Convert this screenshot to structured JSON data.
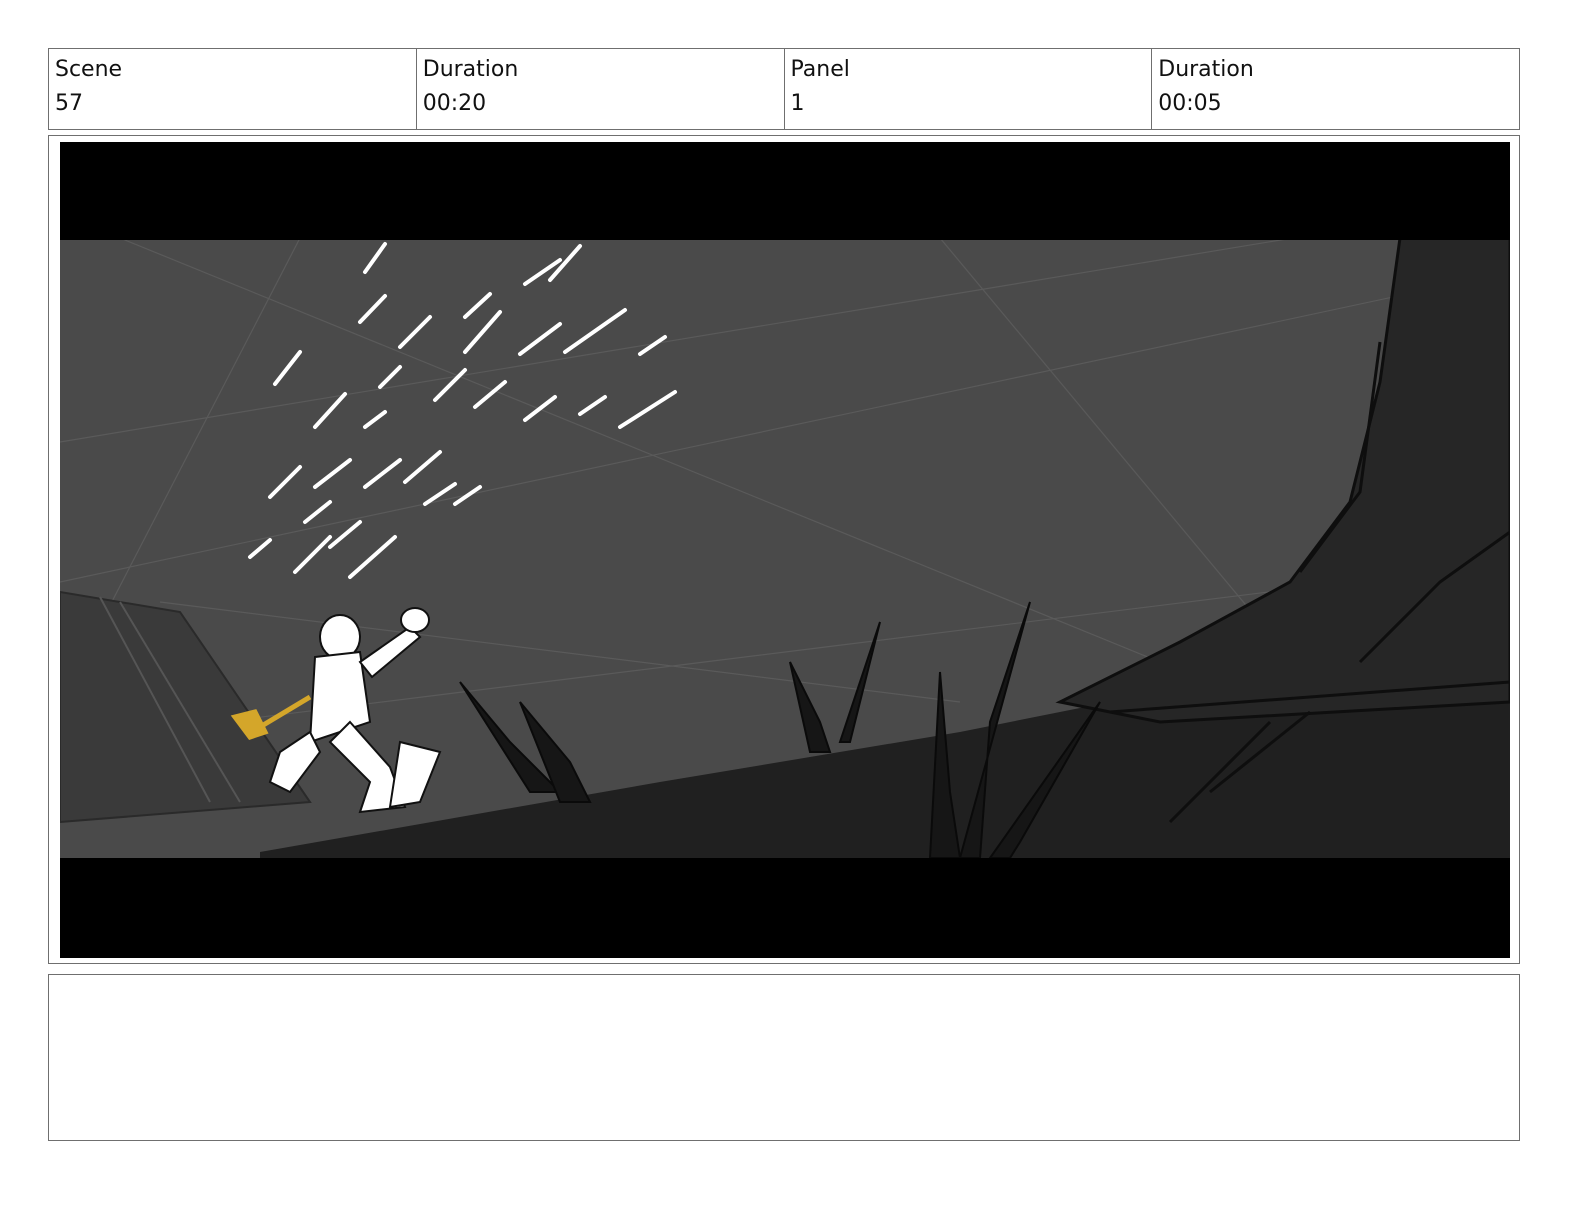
{
  "header": {
    "cells": [
      {
        "label": "Scene",
        "value": "57"
      },
      {
        "label": "Duration",
        "value": "00:20"
      },
      {
        "label": "Panel",
        "value": "1"
      },
      {
        "label": "Duration",
        "value": "00:05"
      }
    ]
  },
  "panel": {
    "letterbox_color": "#000000",
    "sky_color": "#4a4a4a",
    "ground_color": "#202020",
    "figure_color": "#ffffff",
    "slingshot_color": "#d4a62a"
  },
  "notes": {
    "text": ""
  }
}
